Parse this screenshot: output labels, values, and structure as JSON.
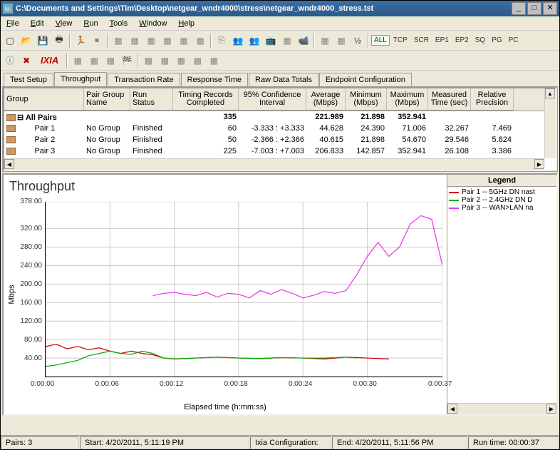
{
  "window": {
    "title": "C:\\Documents and Settings\\Tim\\Desktop\\netgear_wndr4000\\stress\\netgear_wndr4000_stress.tst"
  },
  "menus": [
    "File",
    "Edit",
    "View",
    "Run",
    "Tools",
    "Window",
    "Help"
  ],
  "toolbar2_logo": "IXIA",
  "mode_labels": [
    "ALL",
    "TCP",
    "SCR",
    "EP1",
    "EP2",
    "SQ",
    "PG",
    "PC"
  ],
  "tabs": [
    "Test Setup",
    "Throughput",
    "Transaction Rate",
    "Response Time",
    "Raw Data Totals",
    "Endpoint Configuration"
  ],
  "active_tab": 1,
  "columns": [
    "Group",
    "Pair Group Name",
    "Run Status",
    "Timing Records Completed",
    "95% Confidence Interval",
    "Average (Mbps)",
    "Minimum (Mbps)",
    "Maximum (Mbps)",
    "Measured Time (sec)",
    "Relative Precision"
  ],
  "rows": [
    {
      "group": "All Pairs",
      "pgn": "",
      "rs": "",
      "trc": "335",
      "ci": "",
      "avg": "221.989",
      "min": "21.898",
      "max": "352.941",
      "mt": "",
      "rp": "",
      "bold": true,
      "indent": 0
    },
    {
      "group": "Pair 1",
      "pgn": "No Group",
      "rs": "Finished",
      "trc": "60",
      "ci": "-3.333 : +3.333",
      "avg": "44.628",
      "min": "24.390",
      "max": "71.006",
      "mt": "32.267",
      "rp": "7.469",
      "bold": false,
      "indent": 1
    },
    {
      "group": "Pair 2",
      "pgn": "No Group",
      "rs": "Finished",
      "trc": "50",
      "ci": "-2.366 : +2.366",
      "avg": "40.615",
      "min": "21.898",
      "max": "54.670",
      "mt": "29.546",
      "rp": "5.824",
      "bold": false,
      "indent": 1
    },
    {
      "group": "Pair 3",
      "pgn": "No Group",
      "rs": "Finished",
      "trc": "225",
      "ci": "-7.003 : +7.003",
      "avg": "206.833",
      "min": "142.857",
      "max": "352.941",
      "mt": "26.108",
      "rp": "3.386",
      "bold": false,
      "indent": 1
    }
  ],
  "chart_data": {
    "type": "line",
    "title": "Throughput",
    "ylabel": "Mbps",
    "xlabel": "Elapsed time (h:mm:ss)",
    "ylim": [
      0,
      378
    ],
    "yticks": [
      0,
      40.0,
      80.0,
      120.0,
      160.0,
      200.0,
      240.0,
      280.0,
      320.0,
      378.0
    ],
    "xticks": [
      "0:00:00",
      "0:00:06",
      "0:00:12",
      "0:00:18",
      "0:00:24",
      "0:00:30",
      "0:00:37"
    ],
    "x_seconds": [
      0,
      6,
      12,
      18,
      24,
      30,
      37
    ],
    "series": [
      {
        "name": "Pair 1 -- 5GHz DN nast",
        "color": "#cc0000",
        "x": [
          0,
          1,
          2,
          3,
          4,
          5,
          6,
          7,
          8,
          9,
          10,
          11,
          12,
          14,
          16,
          18,
          20,
          22,
          24,
          26,
          28,
          30,
          32
        ],
        "y": [
          65,
          70,
          60,
          65,
          58,
          62,
          55,
          50,
          55,
          50,
          47,
          40,
          38,
          40,
          42,
          40,
          39,
          41,
          40,
          38,
          42,
          40,
          38
        ]
      },
      {
        "name": "Pair 2 -- 2.4GHz DN D",
        "color": "#00aa00",
        "x": [
          0,
          1,
          2,
          3,
          4,
          5,
          6,
          7,
          8,
          9,
          10,
          11,
          12,
          14,
          16,
          18,
          20,
          22,
          24,
          26,
          28,
          29
        ],
        "y": [
          22,
          25,
          30,
          35,
          45,
          50,
          55,
          50,
          48,
          55,
          50,
          40,
          38,
          40,
          42,
          40,
          39,
          41,
          40,
          40,
          42,
          40
        ]
      },
      {
        "name": "Pair 3 -- WAN>LAN na",
        "color": "#ee33ee",
        "x": [
          10,
          11,
          12,
          13,
          14,
          15,
          16,
          17,
          18,
          19,
          20,
          21,
          22,
          23,
          24,
          25,
          26,
          27,
          28,
          29,
          30,
          31,
          32,
          33,
          34,
          35,
          36,
          37
        ],
        "y": [
          175,
          180,
          182,
          178,
          175,
          182,
          172,
          180,
          178,
          170,
          186,
          178,
          188,
          180,
          170,
          176,
          184,
          180,
          186,
          220,
          260,
          290,
          260,
          280,
          330,
          348,
          340,
          240
        ]
      }
    ]
  },
  "legend_title": "Legend",
  "status": {
    "pairs": "Pairs: 3",
    "start": "Start: 4/20/2011, 5:11:19 PM",
    "config": "Ixia Configuration:",
    "end": "End: 4/20/2011, 5:11:56 PM",
    "runtime": "Run time: 00:00:37"
  },
  "colors": {
    "accent": "#3a6ea5"
  }
}
